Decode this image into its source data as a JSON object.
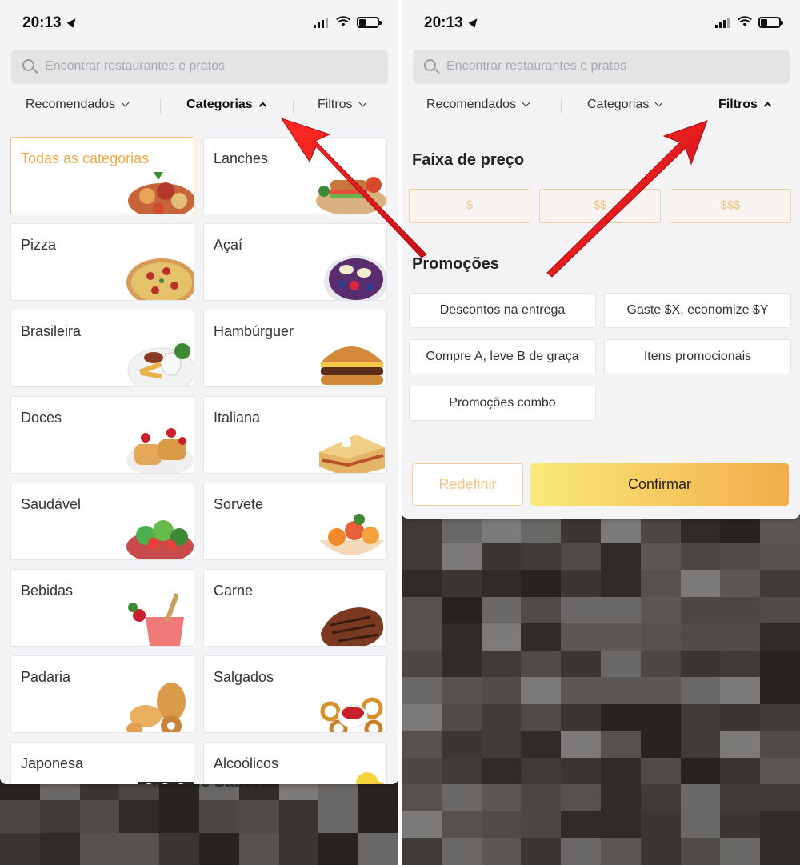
{
  "status": {
    "time": "20:13"
  },
  "search": {
    "placeholder": "Encontrar restaurantes e pratos"
  },
  "filters": {
    "recommended": "Recomendados",
    "categories": "Categorias",
    "filters": "Filtros"
  },
  "categories": [
    {
      "label": "Todas as categorias",
      "selected": true,
      "icon": "mixed-food-platter"
    },
    {
      "label": "Lanches",
      "icon": "sandwich-platter"
    },
    {
      "label": "Pizza",
      "icon": "pizza"
    },
    {
      "label": "Açaí",
      "icon": "acai-bowl"
    },
    {
      "label": "Brasileira",
      "icon": "brazilian-plate"
    },
    {
      "label": "Hambúrguer",
      "icon": "hamburger"
    },
    {
      "label": "Doces",
      "icon": "waffles"
    },
    {
      "label": "Italiana",
      "icon": "lasagna"
    },
    {
      "label": "Saudável",
      "icon": "salad"
    },
    {
      "label": "Sorvete",
      "icon": "fruit-bowl"
    },
    {
      "label": "Bebidas",
      "icon": "drink"
    },
    {
      "label": "Carne",
      "icon": "steak"
    },
    {
      "label": "Padaria",
      "icon": "bread"
    },
    {
      "label": "Salgados",
      "icon": "curly-fries"
    },
    {
      "label": "Japonesa",
      "icon": "sushi"
    },
    {
      "label": "Alcoólicos",
      "icon": "cocktail"
    }
  ],
  "background": {
    "restaurant_name": "Pote de Sabores"
  },
  "filter_panel": {
    "price_title": "Faixa de preço",
    "prices": [
      "$",
      "$$",
      "$$$"
    ],
    "promo_title": "Promoções",
    "promos": [
      "Descontos na entrega",
      "Gaste $X, economize $Y",
      "Compre A, leve B de graça",
      "Itens promocionais",
      "Promoções combo"
    ],
    "reset": "Redefinir",
    "confirm": "Confirmar"
  },
  "colors": {
    "accent": "#f0a94a",
    "arrow": "#e0161b",
    "confirm_gradient_start": "#f9ea7a",
    "confirm_gradient_end": "#f2ad48"
  }
}
